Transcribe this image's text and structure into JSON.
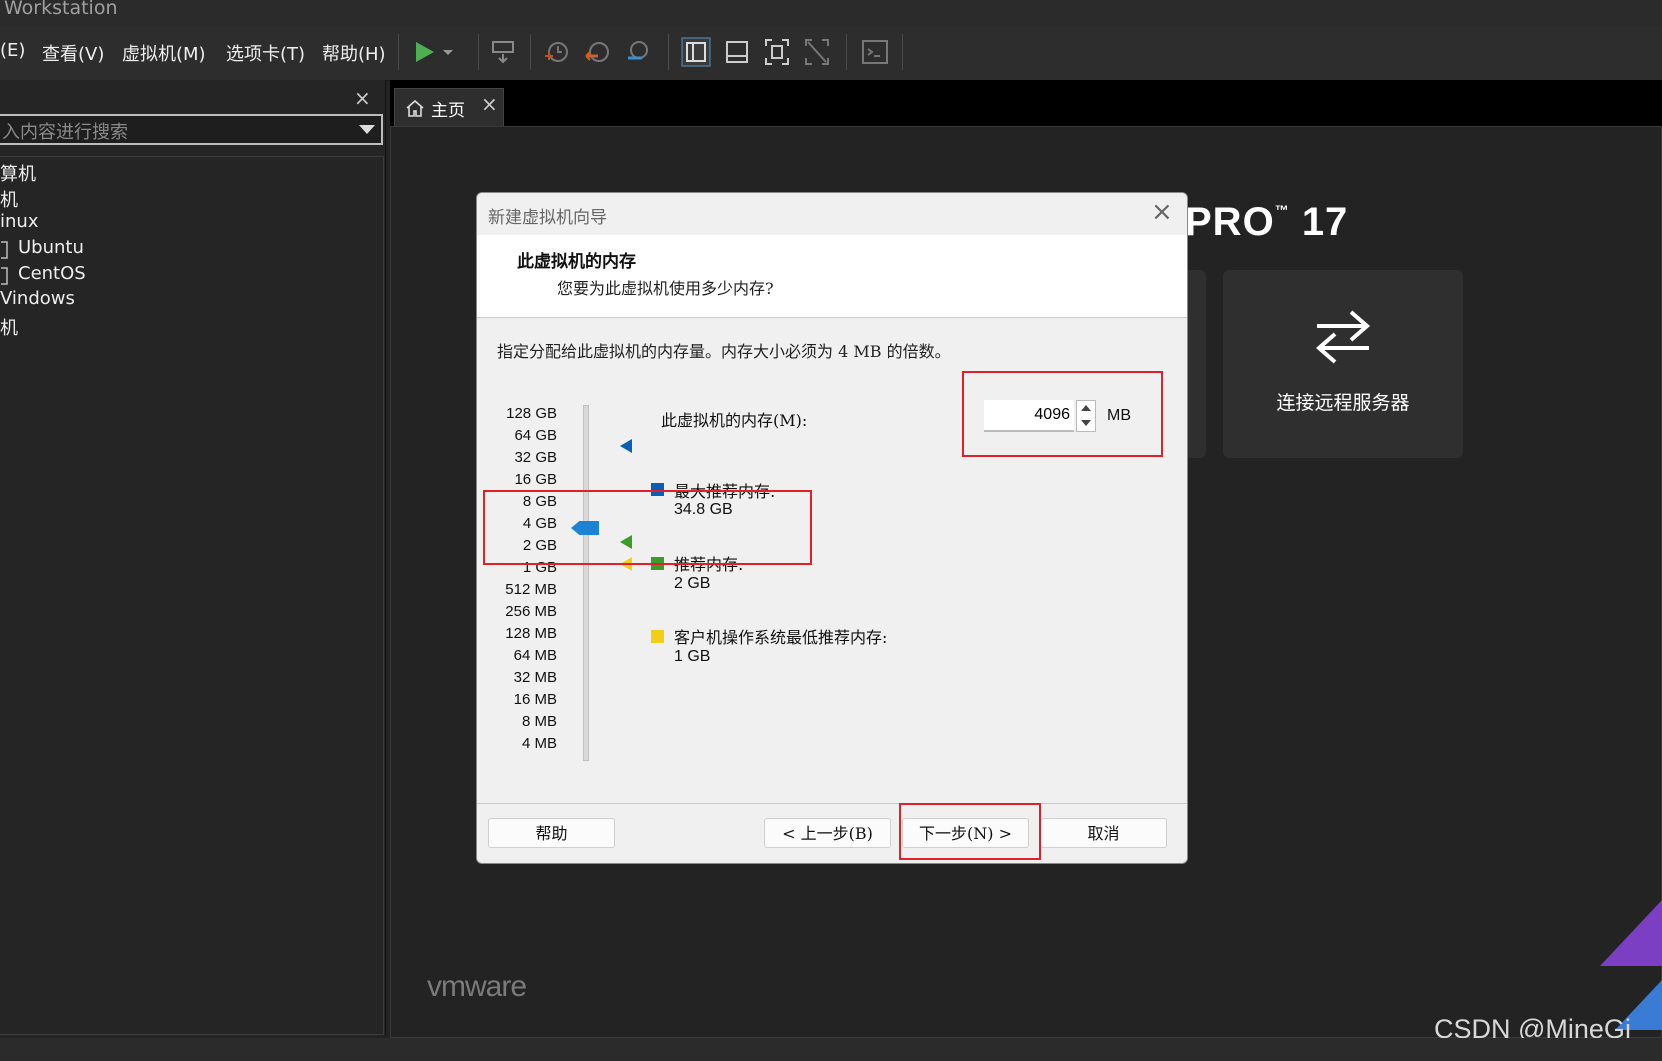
{
  "app": {
    "title": "Workstation"
  },
  "menu": {
    "items": [
      "(E)",
      "查看(V)",
      "虚拟机(M)",
      "选项卡(T)",
      "帮助(H)"
    ]
  },
  "left_panel": {
    "search_placeholder": "入内容进行搜索",
    "close_glyph": "×",
    "tree": [
      {
        "label": "算机",
        "kind": "group"
      },
      {
        "label": "机",
        "kind": "group"
      },
      {
        "label": "inux",
        "kind": "folder"
      },
      {
        "label": "Ubuntu",
        "kind": "vm"
      },
      {
        "label": "CentOS",
        "kind": "vm"
      },
      {
        "label": "Vindows",
        "kind": "folder"
      },
      {
        "label": "机",
        "kind": "group"
      }
    ]
  },
  "tabs": [
    {
      "label": "主页",
      "close_glyph": "×",
      "icon": "home-icon"
    }
  ],
  "home": {
    "brand": "PRO",
    "brand_tm": "™",
    "brand_version": "17",
    "remote_tile_label": "连接远程服务器",
    "vmware_logo": "vmware"
  },
  "dialog": {
    "title": "新建虚拟机向导",
    "close_glyph": "×",
    "heading": "此虚拟机的内存",
    "subheading": "您要为此虚拟机使用多少内存?",
    "description": "指定分配给此虚拟机的内存量。内存大小必须为 4 MB 的倍数。",
    "memory_label": "此虚拟机的内存(M):",
    "memory_value": "4096",
    "memory_unit": "MB",
    "scale_labels": [
      "128 GB",
      "64 GB",
      "32 GB",
      "16 GB",
      "8 GB",
      "4 GB",
      "2 GB",
      "1 GB",
      "512 MB",
      "256 MB",
      "128 MB",
      "64 MB",
      "32 MB",
      "16 MB",
      "8 MB",
      "4 MB"
    ],
    "slider_value": "4 GB",
    "legend": [
      {
        "label": "最大推荐内存:",
        "value": "34.8 GB",
        "color": "#0a5fb4"
      },
      {
        "label": "推荐内存:",
        "value": "2 GB",
        "color": "#3a9c2a"
      },
      {
        "label": "客户机操作系统最低推荐内存:",
        "value": "1 GB",
        "color": "#f2cf14"
      }
    ],
    "buttons": {
      "help": "帮助",
      "back": "< 上一步(B)",
      "next": "下一步(N) >",
      "cancel": "取消"
    }
  },
  "watermark": "CSDN @MineGi",
  "colors": {
    "highlight_red": "#e0202a",
    "slider_blue": "#1c82d4",
    "dark_bg": "#232323"
  }
}
